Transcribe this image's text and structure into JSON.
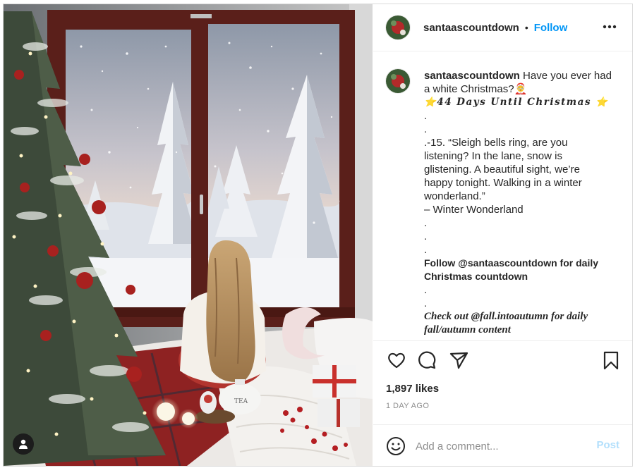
{
  "post": {
    "username": "santaascountdown",
    "separator": "•",
    "follow_label": "Follow",
    "more_icon": "more-horizontal-icon",
    "caption": {
      "username": "santaascountdown",
      "lines": [
        "Have you ever had",
        "a white Christmas?🤶",
        "⭐44 𝑫𝒂𝒚𝒔 𝑼𝒏𝒕𝒊𝒍 𝑪𝒉𝒓𝒊𝒔𝒕𝒎𝒂𝒔 ⭐",
        ".",
        ".",
        ".-15. “Sleigh bells ring, are you",
        "listening? In the lane, snow is",
        "glistening. A beautiful sight, we’re",
        "happy tonight. Walking in a winter",
        "wonderland.”",
        "– Winter Wonderland",
        ".",
        ".",
        ".",
        "Follow @santaascountdown for daily",
        "Christmas countdown",
        ".",
        ".",
        "Check out @fall.intoautumn for daily",
        "fall/autumn content"
      ]
    },
    "actions": {
      "like_icon": "heart-icon",
      "comment_icon": "comment-icon",
      "share_icon": "paper-plane-icon",
      "save_icon": "bookmark-icon"
    },
    "likes": "1,897 likes",
    "timestamp": "1 DAY AGO",
    "comment": {
      "emoji_icon": "smiley-icon",
      "placeholder": "Add a comment...",
      "post_label": "Post"
    }
  },
  "colors": {
    "link_blue": "#0095f6",
    "post_disabled": "#b2dffc",
    "text": "#262626",
    "muted": "#8e8e8e",
    "border": "#dbdbdb"
  }
}
